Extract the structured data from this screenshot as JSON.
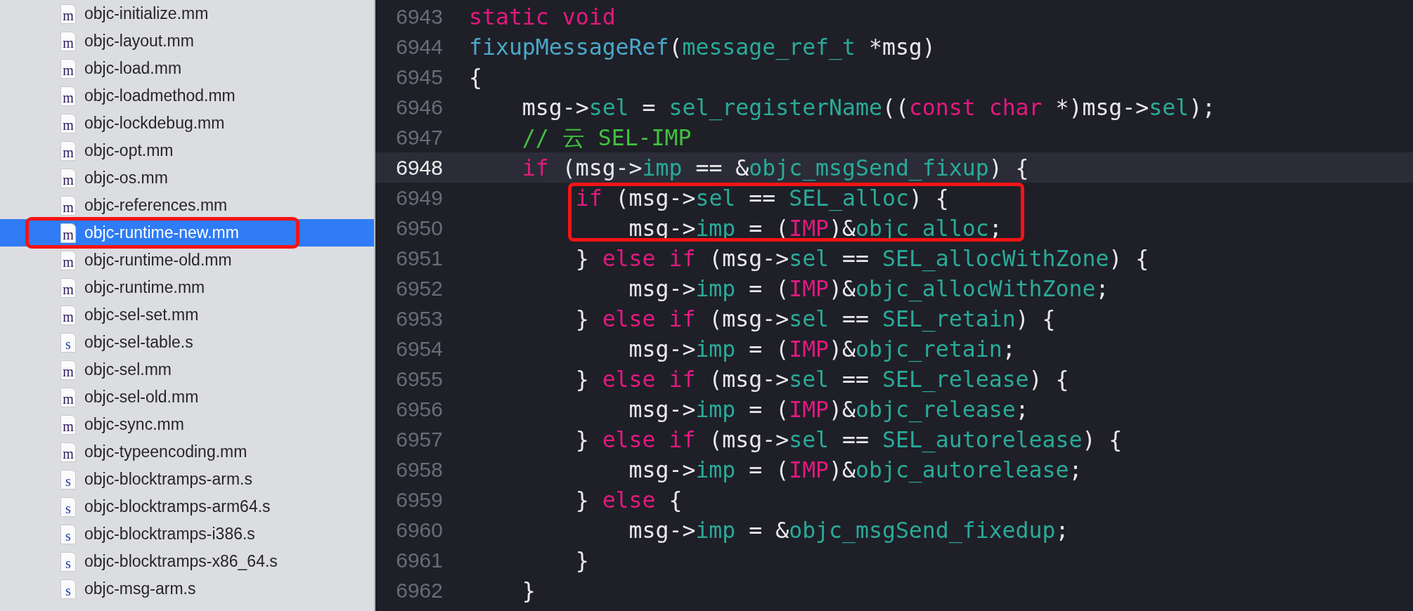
{
  "sidebar": {
    "files": [
      {
        "name": "objc-initialize.mm",
        "kind": "mm",
        "letter": "m",
        "selected": false,
        "annotated": false
      },
      {
        "name": "objc-layout.mm",
        "kind": "mm",
        "letter": "m",
        "selected": false,
        "annotated": false
      },
      {
        "name": "objc-load.mm",
        "kind": "mm",
        "letter": "m",
        "selected": false,
        "annotated": false
      },
      {
        "name": "objc-loadmethod.mm",
        "kind": "mm",
        "letter": "m",
        "selected": false,
        "annotated": false
      },
      {
        "name": "objc-lockdebug.mm",
        "kind": "mm",
        "letter": "m",
        "selected": false,
        "annotated": false
      },
      {
        "name": "objc-opt.mm",
        "kind": "mm",
        "letter": "m",
        "selected": false,
        "annotated": false
      },
      {
        "name": "objc-os.mm",
        "kind": "mm",
        "letter": "m",
        "selected": false,
        "annotated": false
      },
      {
        "name": "objc-references.mm",
        "kind": "mm",
        "letter": "m",
        "selected": false,
        "annotated": false
      },
      {
        "name": "objc-runtime-new.mm",
        "kind": "mm",
        "letter": "m",
        "selected": true,
        "annotated": true
      },
      {
        "name": "objc-runtime-old.mm",
        "kind": "mm",
        "letter": "m",
        "selected": false,
        "annotated": false
      },
      {
        "name": "objc-runtime.mm",
        "kind": "mm",
        "letter": "m",
        "selected": false,
        "annotated": false
      },
      {
        "name": "objc-sel-set.mm",
        "kind": "mm",
        "letter": "m",
        "selected": false,
        "annotated": false
      },
      {
        "name": "objc-sel-table.s",
        "kind": "s",
        "letter": "s",
        "selected": false,
        "annotated": false
      },
      {
        "name": "objc-sel.mm",
        "kind": "mm",
        "letter": "m",
        "selected": false,
        "annotated": false
      },
      {
        "name": "objc-sel-old.mm",
        "kind": "mm",
        "letter": "m",
        "selected": false,
        "annotated": false
      },
      {
        "name": "objc-sync.mm",
        "kind": "mm",
        "letter": "m",
        "selected": false,
        "annotated": false
      },
      {
        "name": "objc-typeencoding.mm",
        "kind": "mm",
        "letter": "m",
        "selected": false,
        "annotated": false
      },
      {
        "name": "objc-blocktramps-arm.s",
        "kind": "s",
        "letter": "s",
        "selected": false,
        "annotated": false
      },
      {
        "name": "objc-blocktramps-arm64.s",
        "kind": "s",
        "letter": "s",
        "selected": false,
        "annotated": false
      },
      {
        "name": "objc-blocktramps-i386.s",
        "kind": "s",
        "letter": "s",
        "selected": false,
        "annotated": false
      },
      {
        "name": "objc-blocktramps-x86_64.s",
        "kind": "s",
        "letter": "s",
        "selected": false,
        "annotated": false
      },
      {
        "name": "objc-msg-arm.s",
        "kind": "s",
        "letter": "s",
        "selected": false,
        "annotated": false
      }
    ]
  },
  "editor": {
    "lines": [
      {
        "number": "6943",
        "current": false,
        "boxed": false,
        "tokens": [
          {
            "kind": "keyword",
            "s": "static void"
          }
        ]
      },
      {
        "number": "6944",
        "current": false,
        "boxed": false,
        "tokens": [
          {
            "kind": "function",
            "s": "fixupMessageRef"
          },
          {
            "kind": "plain",
            "s": "("
          },
          {
            "kind": "ident",
            "s": "message_ref_t"
          },
          {
            "kind": "plain",
            "s": " *msg)"
          }
        ]
      },
      {
        "number": "6945",
        "current": false,
        "boxed": false,
        "tokens": [
          {
            "kind": "plain",
            "s": "{"
          }
        ]
      },
      {
        "number": "6946",
        "current": false,
        "boxed": false,
        "tokens": [
          {
            "kind": "plain",
            "s": "    msg->"
          },
          {
            "kind": "ident",
            "s": "sel"
          },
          {
            "kind": "plain",
            "s": " = "
          },
          {
            "kind": "ident",
            "s": "sel_registerName"
          },
          {
            "kind": "plain",
            "s": "(("
          },
          {
            "kind": "keyword",
            "s": "const char"
          },
          {
            "kind": "plain",
            "s": " *)msg->"
          },
          {
            "kind": "ident",
            "s": "sel"
          },
          {
            "kind": "plain",
            "s": ");"
          }
        ]
      },
      {
        "number": "6947",
        "current": false,
        "boxed": false,
        "tokens": [
          {
            "kind": "comment",
            "s": "    // 云 SEL-IMP"
          }
        ]
      },
      {
        "number": "6948",
        "current": true,
        "boxed": false,
        "tokens": [
          {
            "kind": "keyword",
            "s": "    if"
          },
          {
            "kind": "plain",
            "s": " (msg->"
          },
          {
            "kind": "ident",
            "s": "imp"
          },
          {
            "kind": "plain",
            "s": " == &"
          },
          {
            "kind": "ident",
            "s": "objc_msgSend_fixup"
          },
          {
            "kind": "plain",
            "s": ") {"
          }
        ]
      },
      {
        "number": "6949",
        "current": false,
        "boxed": true,
        "tokens": [
          {
            "kind": "keyword",
            "s": "        if"
          },
          {
            "kind": "plain",
            "s": " (msg->"
          },
          {
            "kind": "ident",
            "s": "sel"
          },
          {
            "kind": "plain",
            "s": " == "
          },
          {
            "kind": "ident",
            "s": "SEL_alloc"
          },
          {
            "kind": "plain",
            "s": ") {"
          }
        ]
      },
      {
        "number": "6950",
        "current": false,
        "boxed": true,
        "tokens": [
          {
            "kind": "plain",
            "s": "            msg->"
          },
          {
            "kind": "ident",
            "s": "imp"
          },
          {
            "kind": "plain",
            "s": " = ("
          },
          {
            "kind": "keyword",
            "s": "IMP"
          },
          {
            "kind": "plain",
            "s": ")&"
          },
          {
            "kind": "ident",
            "s": "objc_alloc"
          },
          {
            "kind": "plain",
            "s": ";"
          }
        ]
      },
      {
        "number": "6951",
        "current": false,
        "boxed": false,
        "tokens": [
          {
            "kind": "plain",
            "s": "        } "
          },
          {
            "kind": "keyword",
            "s": "else if"
          },
          {
            "kind": "plain",
            "s": " (msg->"
          },
          {
            "kind": "ident",
            "s": "sel"
          },
          {
            "kind": "plain",
            "s": " == "
          },
          {
            "kind": "ident",
            "s": "SEL_allocWithZone"
          },
          {
            "kind": "plain",
            "s": ") {"
          }
        ]
      },
      {
        "number": "6952",
        "current": false,
        "boxed": false,
        "tokens": [
          {
            "kind": "plain",
            "s": "            msg->"
          },
          {
            "kind": "ident",
            "s": "imp"
          },
          {
            "kind": "plain",
            "s": " = ("
          },
          {
            "kind": "keyword",
            "s": "IMP"
          },
          {
            "kind": "plain",
            "s": ")&"
          },
          {
            "kind": "ident",
            "s": "objc_allocWithZone"
          },
          {
            "kind": "plain",
            "s": ";"
          }
        ]
      },
      {
        "number": "6953",
        "current": false,
        "boxed": false,
        "tokens": [
          {
            "kind": "plain",
            "s": "        } "
          },
          {
            "kind": "keyword",
            "s": "else if"
          },
          {
            "kind": "plain",
            "s": " (msg->"
          },
          {
            "kind": "ident",
            "s": "sel"
          },
          {
            "kind": "plain",
            "s": " == "
          },
          {
            "kind": "ident",
            "s": "SEL_retain"
          },
          {
            "kind": "plain",
            "s": ") {"
          }
        ]
      },
      {
        "number": "6954",
        "current": false,
        "boxed": false,
        "tokens": [
          {
            "kind": "plain",
            "s": "            msg->"
          },
          {
            "kind": "ident",
            "s": "imp"
          },
          {
            "kind": "plain",
            "s": " = ("
          },
          {
            "kind": "keyword",
            "s": "IMP"
          },
          {
            "kind": "plain",
            "s": ")&"
          },
          {
            "kind": "ident",
            "s": "objc_retain"
          },
          {
            "kind": "plain",
            "s": ";"
          }
        ]
      },
      {
        "number": "6955",
        "current": false,
        "boxed": false,
        "tokens": [
          {
            "kind": "plain",
            "s": "        } "
          },
          {
            "kind": "keyword",
            "s": "else if"
          },
          {
            "kind": "plain",
            "s": " (msg->"
          },
          {
            "kind": "ident",
            "s": "sel"
          },
          {
            "kind": "plain",
            "s": " == "
          },
          {
            "kind": "ident",
            "s": "SEL_release"
          },
          {
            "kind": "plain",
            "s": ") {"
          }
        ]
      },
      {
        "number": "6956",
        "current": false,
        "boxed": false,
        "tokens": [
          {
            "kind": "plain",
            "s": "            msg->"
          },
          {
            "kind": "ident",
            "s": "imp"
          },
          {
            "kind": "plain",
            "s": " = ("
          },
          {
            "kind": "keyword",
            "s": "IMP"
          },
          {
            "kind": "plain",
            "s": ")&"
          },
          {
            "kind": "ident",
            "s": "objc_release"
          },
          {
            "kind": "plain",
            "s": ";"
          }
        ]
      },
      {
        "number": "6957",
        "current": false,
        "boxed": false,
        "tokens": [
          {
            "kind": "plain",
            "s": "        } "
          },
          {
            "kind": "keyword",
            "s": "else if"
          },
          {
            "kind": "plain",
            "s": " (msg->"
          },
          {
            "kind": "ident",
            "s": "sel"
          },
          {
            "kind": "plain",
            "s": " == "
          },
          {
            "kind": "ident",
            "s": "SEL_autorelease"
          },
          {
            "kind": "plain",
            "s": ") {"
          }
        ]
      },
      {
        "number": "6958",
        "current": false,
        "boxed": false,
        "tokens": [
          {
            "kind": "plain",
            "s": "            msg->"
          },
          {
            "kind": "ident",
            "s": "imp"
          },
          {
            "kind": "plain",
            "s": " = ("
          },
          {
            "kind": "keyword",
            "s": "IMP"
          },
          {
            "kind": "plain",
            "s": ")&"
          },
          {
            "kind": "ident",
            "s": "objc_autorelease"
          },
          {
            "kind": "plain",
            "s": ";"
          }
        ]
      },
      {
        "number": "6959",
        "current": false,
        "boxed": false,
        "tokens": [
          {
            "kind": "plain",
            "s": "        } "
          },
          {
            "kind": "keyword",
            "s": "else"
          },
          {
            "kind": "plain",
            "s": " {"
          }
        ]
      },
      {
        "number": "6960",
        "current": false,
        "boxed": false,
        "tokens": [
          {
            "kind": "plain",
            "s": "            msg->"
          },
          {
            "kind": "ident",
            "s": "imp"
          },
          {
            "kind": "plain",
            "s": " = &"
          },
          {
            "kind": "ident",
            "s": "objc_msgSend_fixedup"
          },
          {
            "kind": "plain",
            "s": ";"
          }
        ]
      },
      {
        "number": "6961",
        "current": false,
        "boxed": false,
        "tokens": [
          {
            "kind": "plain",
            "s": "        }"
          }
        ]
      },
      {
        "number": "6962",
        "current": false,
        "boxed": false,
        "tokens": [
          {
            "kind": "plain",
            "s": "    }"
          }
        ]
      }
    ]
  }
}
